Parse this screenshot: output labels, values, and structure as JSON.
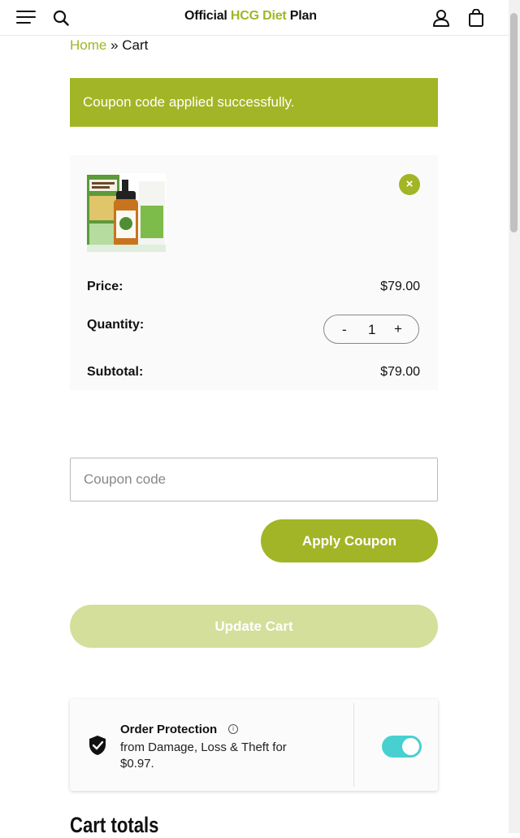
{
  "header": {
    "logo_prefix": "Official ",
    "logo_accent": "HCG Diet",
    "logo_suffix": " Plan"
  },
  "breadcrumb": {
    "home": "Home",
    "separator": " » ",
    "current": "Cart"
  },
  "notice": {
    "message": "Coupon code applied successfully."
  },
  "cart_item": {
    "remove": "×",
    "price_label": "Price:",
    "price": "$79.00",
    "quantity_label": "Quantity:",
    "qty_minus": "-",
    "quantity": "1",
    "qty_plus": "+",
    "subtotal_label": "Subtotal:",
    "subtotal": "$79.00"
  },
  "coupon": {
    "placeholder": "Coupon code",
    "apply_label": "Apply Coupon"
  },
  "update_label": "Update Cart",
  "protection": {
    "title": "Order Protection",
    "info": "i",
    "description": "from Damage, Loss & Theft for $0.97.",
    "enabled": true
  },
  "totals_heading": "Cart totals",
  "colors": {
    "accent": "#a2b526",
    "accent_light": "#d3df9a",
    "toggle": "#47d0cf"
  }
}
